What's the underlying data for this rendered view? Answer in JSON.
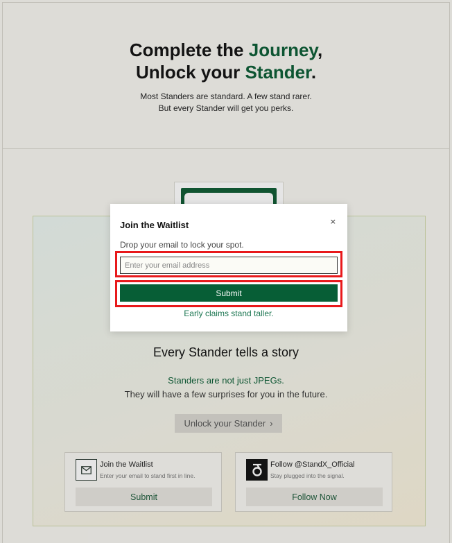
{
  "hero": {
    "title_line1_a": "Complete the ",
    "title_line1_b": "Journey",
    "title_line1_c": ",",
    "title_line2_a": "Unlock your ",
    "title_line2_b": "Stander",
    "title_line2_c": ".",
    "subtitle_line1": "Most Standers are standard. A few stand rarer.",
    "subtitle_line2": "But every Stander will get you perks."
  },
  "story": {
    "title": "Every Stander tells a story",
    "line1": "Standers are not just JPEGs.",
    "line2": "They will have a few surprises for you in the future.",
    "unlock_label": "Unlock your Stander",
    "unlock_chevron": "›"
  },
  "cards": [
    {
      "title": "Join the Waitlist",
      "desc": "Enter your email to stand first in line.",
      "button": "Submit",
      "icon": "mail-icon"
    },
    {
      "title": "Follow @StandX_Official",
      "desc": "Stay plugged into the signal.",
      "button": "Follow Now",
      "icon": "standx-logo-icon"
    }
  ],
  "modal": {
    "title": "Join the Waitlist",
    "close": "×",
    "desc": "Drop your email to lock your spot.",
    "email_placeholder": "Enter your email address",
    "submit": "Submit",
    "note": "Early claims stand taller."
  },
  "colors": {
    "brand_green": "#075e36",
    "highlight_red": "#e8191b"
  }
}
